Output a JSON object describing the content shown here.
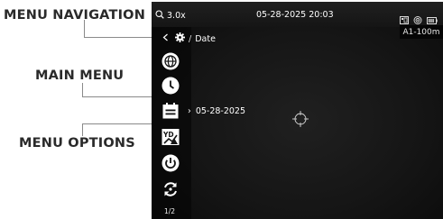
{
  "callouts": {
    "menu_navigation": "MENU NAVIGATION",
    "main_menu": "MAIN MENU",
    "menu_options": "MENU OPTIONS"
  },
  "status_bar": {
    "zoom": "3.0x",
    "datetime": "05-28-2025 20:03",
    "icons": [
      "sd-card-icon",
      "wifi-icon",
      "battery-icon"
    ]
  },
  "range_badge": "A1-100m",
  "breadcrumb": {
    "back_icon": "chevron-left-icon",
    "settings_icon": "gear-icon",
    "separator": "/",
    "current": "Date"
  },
  "main_menu": {
    "items": [
      {
        "icon": "globe-icon"
      },
      {
        "icon": "clock-icon"
      },
      {
        "icon": "calendar-icon"
      },
      {
        "icon": "video-mode-icon"
      },
      {
        "icon": "power-icon"
      },
      {
        "icon": "reset-icon"
      }
    ],
    "page_indicator": "1/2"
  },
  "option": {
    "arrow": "›",
    "value": "05-28-2025"
  },
  "colors": {
    "screen_bg": "#151515",
    "callout_text": "#2a2a2a",
    "leader": "#8a8a8a",
    "text": "#ffffff"
  }
}
